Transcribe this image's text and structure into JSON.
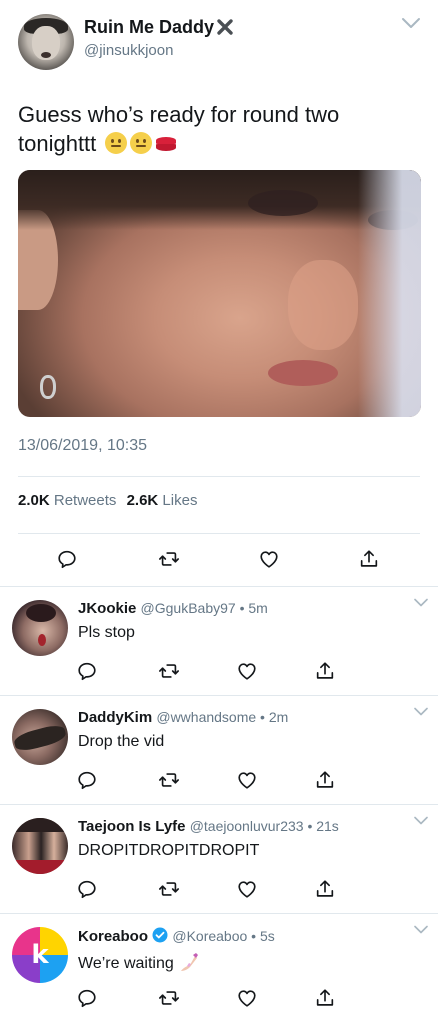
{
  "tweet": {
    "display_name": "Ruin Me Daddy",
    "handle": "@jinsukkjoon",
    "text": "Guess who’s ready for round two tonighttt",
    "timestamp": "13/06/2019, 10:35",
    "retweets_count": "2.0K",
    "retweets_label": "Retweets",
    "likes_count": "2.6K",
    "likes_label": "Likes"
  },
  "replies": [
    {
      "name": "JKookie",
      "meta": "@GgukBaby97 • 5m",
      "text": "Pls stop"
    },
    {
      "name": "DaddyKim",
      "meta": "@wwhandsome • 2m",
      "text": "Drop the vid"
    },
    {
      "name": "Taejoon Is Lyfe",
      "meta": "@taejoonluvur233 • 21s",
      "text": "DROPITDROPITDROPIT"
    },
    {
      "name": "Koreaboo",
      "meta": "@Koreaboo • 5s",
      "text": "We’re waiting"
    }
  ],
  "icons": {
    "reply": "reply-icon",
    "retweet": "retweet-icon",
    "like": "heart-icon",
    "share": "share-icon",
    "chevron": "chevron-down-icon",
    "x_mark": "x-mark-icon",
    "verified": "verified-icon"
  },
  "colors": {
    "text": "#14171a",
    "secondary": "#657786",
    "divider": "#e1e8ed",
    "verified": "#1da1f2"
  }
}
